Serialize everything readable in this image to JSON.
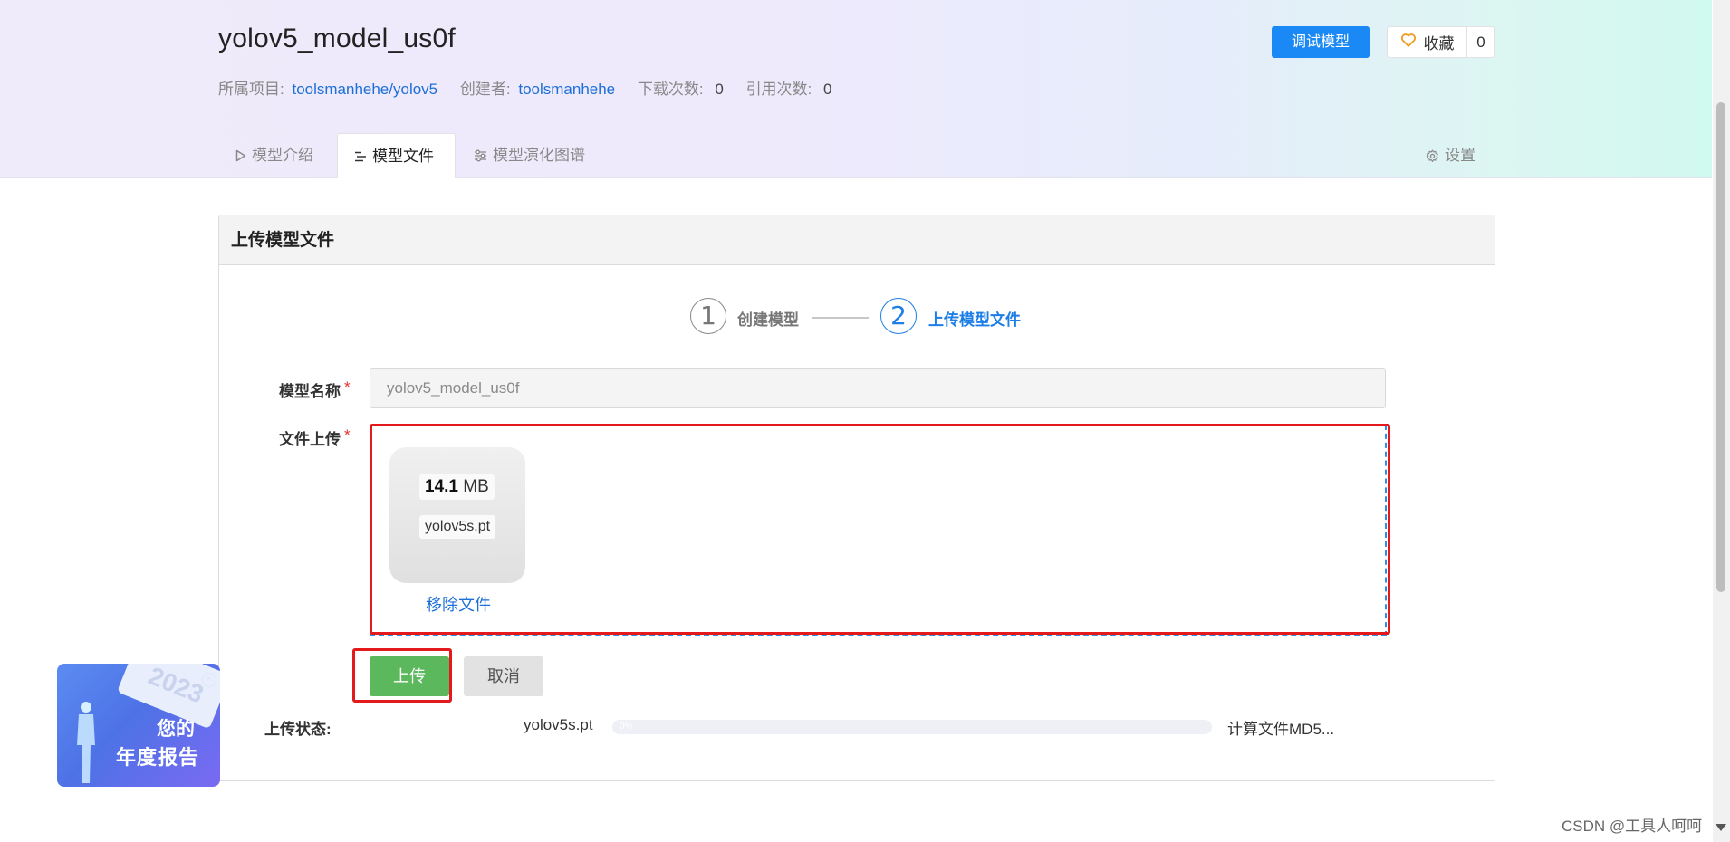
{
  "header": {
    "title": "yolov5_model_us0f",
    "meta": {
      "project_label": "所属项目:",
      "project_value": "toolsmanhehe/yolov5",
      "creator_label": "创建者:",
      "creator_value": "toolsmanhehe",
      "downloads_label": "下载次数:",
      "downloads_value": "0",
      "citations_label": "引用次数:",
      "citations_value": "0"
    },
    "debug_button": "调试模型",
    "favorite": {
      "label": "收藏",
      "count": "0"
    }
  },
  "tabs": [
    {
      "label": "模型介绍",
      "icon": "play-triangle-icon",
      "active": false
    },
    {
      "label": "模型文件",
      "icon": "file-lines-icon",
      "active": true
    },
    {
      "label": "模型演化图谱",
      "icon": "sliders-icon",
      "active": false
    }
  ],
  "settings_label": "设置",
  "card": {
    "title": "上传模型文件",
    "steps": [
      {
        "number": "1",
        "label": "创建模型",
        "state": "done"
      },
      {
        "number": "2",
        "label": "上传模型文件",
        "state": "active"
      }
    ],
    "form": {
      "name_label": "模型名称",
      "name_value": "yolov5_model_us0f",
      "upload_label": "文件上传",
      "required_mark": "*"
    },
    "file": {
      "size_number": "14.1",
      "size_unit": "MB",
      "name": "yolov5s.pt",
      "remove_label": "移除文件"
    },
    "buttons": {
      "upload": "上传",
      "cancel": "取消"
    },
    "status": {
      "label": "上传状态:",
      "file_name": "yolov5s.pt",
      "progress": 0,
      "progress_text": "0%",
      "message": "计算文件MD5..."
    }
  },
  "promo": {
    "year": "2023",
    "line1": "您的",
    "line2": "年度报告"
  },
  "watermark": "CSDN @工具人呵呵",
  "colors": {
    "primary": "#1b89f5",
    "link": "#1c6fd8",
    "success": "#5cb85c",
    "highlight_red": "#e3191c",
    "required": "#e03030"
  }
}
